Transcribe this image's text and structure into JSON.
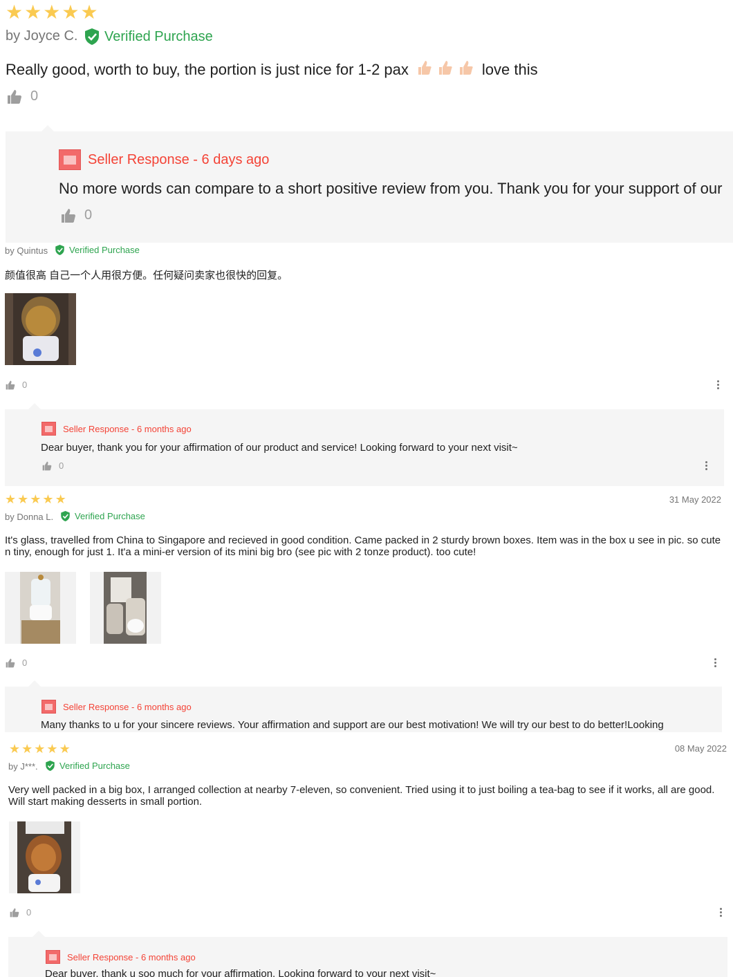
{
  "review1": {
    "stars": 5,
    "author": "by Joyce C.",
    "verified": "Verified Purchase",
    "text_before": "Really good, worth to buy, the portion is just nice for 1-2 pax",
    "text_after": "love this",
    "emoji_icon": "thumbs-up-emoji",
    "likes": "0",
    "seller": {
      "heading": "Seller Response - 6 days ago",
      "text": "No more words can compare to a short positive review from you. Thank you for your support of our",
      "likes": "0"
    }
  },
  "review2": {
    "author": "by Quintus",
    "verified": "Verified Purchase",
    "text": "颜值很高 自己一个人用很方便。任何疑问卖家也很快的回复。",
    "likes": "0",
    "seller": {
      "heading": "Seller Response - 6 months ago",
      "text": "Dear buyer, thank you for your affirmation of our product and service! Looking forward to your next visit~",
      "likes": "0"
    }
  },
  "review3": {
    "stars": 5,
    "date": "31 May 2022",
    "author": "by Donna L.",
    "verified": "Verified Purchase",
    "text": "It's glass, travelled from China to Singapore and recieved in good condition. Came packed in 2 sturdy brown boxes. Item was in the box u see in pic. so cute n tiny, enough for just 1. It'a a mini-er version of its mini big bro (see pic with 2 tonze product). too cute!",
    "likes": "0",
    "seller": {
      "heading": "Seller Response - 6 months ago",
      "text": "Many thanks to u for your sincere reviews. Your affirmation and support are our best motivation! We will try our best to do better!Looking"
    }
  },
  "review4": {
    "stars": 5,
    "date": "08 May 2022",
    "author": "by J***.",
    "verified": "Verified Purchase",
    "text": "Very well packed in a big box, I arranged collection at nearby 7-eleven, so convenient. Tried using it to just boiling a tea-bag to see if it works, all are good. Will start making desserts in small portion.",
    "likes": "0",
    "seller": {
      "heading": "Seller Response - 6 months ago",
      "text": "Dear buyer, thank u soo much for your affirmation. Looking forward to your next visit~"
    }
  },
  "colors": {
    "star": "#faca51",
    "verified": "#2ea44f",
    "seller_heading": "#f44336",
    "panel": "#f5f5f5"
  }
}
